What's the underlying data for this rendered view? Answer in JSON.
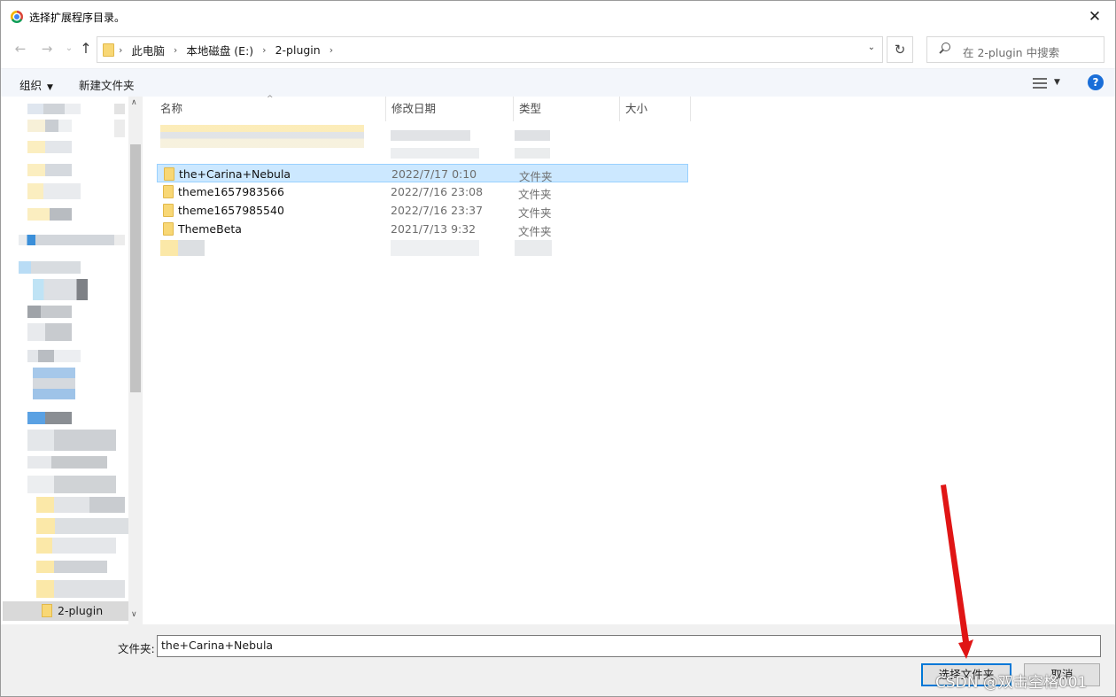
{
  "window": {
    "title": "选择扩展程序目录。",
    "close_glyph": "✕"
  },
  "nav": {
    "back_glyph": "←",
    "forward_glyph": "→",
    "up_glyph": "↑",
    "breadcrumbs": [
      "此电脑",
      "本地磁盘 (E:)",
      "2-plugin"
    ],
    "separator_glyph": "›",
    "dropdown_glyph": "⌄",
    "refresh_glyph": "↻",
    "search_placeholder": "在 2-plugin 中搜索"
  },
  "toolbar": {
    "organize_label": "组织",
    "new_folder_label": "新建文件夹",
    "caret_glyph": "▼",
    "help_glyph": "?"
  },
  "navpane": {
    "selected_item": "2-plugin",
    "scroll_up_glyph": "∧",
    "scroll_down_glyph": "∨"
  },
  "columns": {
    "name": "名称",
    "date": "修改日期",
    "type": "类型",
    "size": "大小",
    "sort_glyph": "^"
  },
  "files": [
    {
      "name": "the+Carina+Nebula",
      "date": "2022/7/17 0:10",
      "type": "文件夹",
      "selected": true
    },
    {
      "name": "theme1657983566",
      "date": "2022/7/16 23:08",
      "type": "文件夹",
      "selected": false
    },
    {
      "name": "theme1657985540",
      "date": "2022/7/16 23:37",
      "type": "文件夹",
      "selected": false
    },
    {
      "name": "ThemeBeta",
      "date": "2021/7/13 9:32",
      "type": "文件夹",
      "selected": false
    }
  ],
  "bottom": {
    "folder_label": "文件夹:",
    "folder_value": "the+Carina+Nebula",
    "select_button": "选择文件夹",
    "cancel_button": "取消"
  },
  "watermark": "CSDN @双击空格001",
  "colors": {
    "selection_bg": "#cce8ff",
    "accent": "#0078d7",
    "annotation_arrow": "#e01515"
  }
}
